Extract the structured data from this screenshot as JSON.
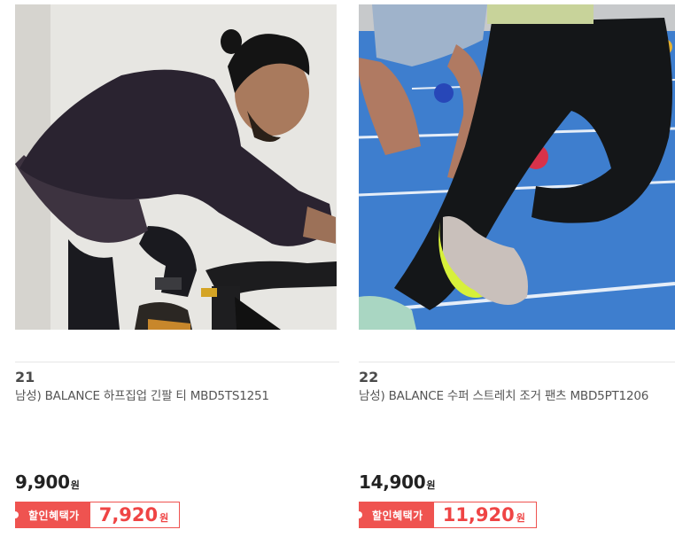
{
  "products": [
    {
      "rank": "21",
      "name": "남성) BALANCE 하프집업 긴팔 티 MBD5TS1251",
      "price": "9,900",
      "price_unit": "원",
      "discount_label": "할인혜택가",
      "discount_price": "7,920",
      "discount_unit": "원",
      "image_description": "man-cycling-dark-halfzip"
    },
    {
      "rank": "22",
      "name": "남성) BALANCE 수퍼 스트레치 조거 팬츠 MBD5PT1206",
      "price": "14,900",
      "price_unit": "원",
      "discount_label": "할인혜택가",
      "discount_price": "11,920",
      "discount_unit": "원",
      "image_description": "runner-black-jogger-pants-track"
    }
  ],
  "colors": {
    "accent": "#ef5350",
    "track_blue": "#3f7fcf"
  }
}
